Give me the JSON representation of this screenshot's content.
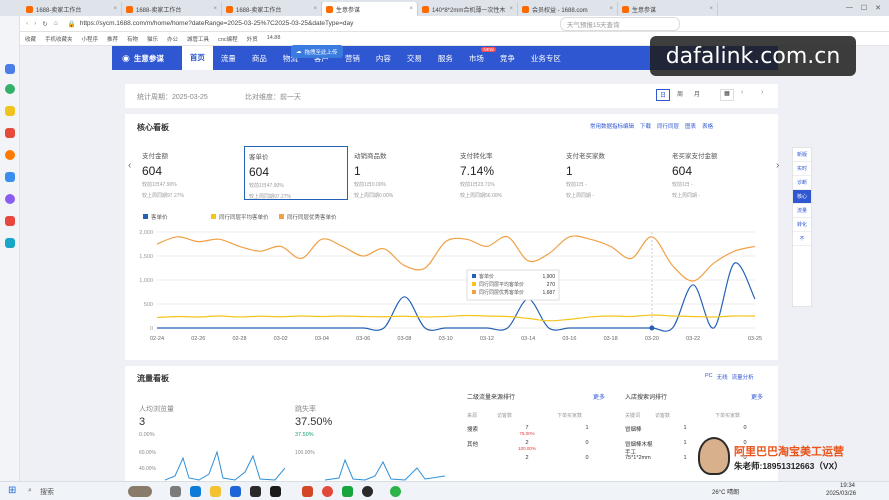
{
  "browser": {
    "tabs": [
      {
        "label": "1688-卖家工作台",
        "active": false
      },
      {
        "label": "1688-卖家工作台",
        "active": false
      },
      {
        "label": "1688-卖家工作台",
        "active": false
      },
      {
        "label": "生意参谋",
        "active": true
      },
      {
        "label": "140*8*2mm合机薄一次性木",
        "active": false
      },
      {
        "label": "会员权益 - 1688.com",
        "active": false
      },
      {
        "label": "生意参谋",
        "active": false
      }
    ],
    "url": "https://sycm.1688.com/m/home/home?dateRange=2025-03-25%7C2025-03-25&dateType=day",
    "search_placeholder": "天气预报15天查询",
    "bookmarks": [
      "收藏",
      "手机收藏夹",
      "小程序",
      "推荐",
      "有物",
      "猫乐",
      "办公",
      "城管工具",
      "cnc编程",
      "外贸",
      "14.88"
    ],
    "upload_badge": "拖拽至此上传"
  },
  "nav": {
    "logo": "生意参谋",
    "items": [
      "首页",
      "流量",
      "商品",
      "物流",
      "客户",
      "营销",
      "内容",
      "交易",
      "服务",
      "市场",
      "竞争",
      "业务专区"
    ],
    "market_badge": "NEW"
  },
  "stats": {
    "period_label": "统计周期：2025-03-25",
    "dim_label": "比对维度：前一天",
    "date_tabs": [
      "日",
      "周",
      "月"
    ]
  },
  "core": {
    "title": "核心看板",
    "links": [
      "常用数据指标编辑",
      "下载",
      "同行同层",
      "图表",
      "表格"
    ],
    "kpis": [
      {
        "title": "支付金额",
        "value": "604",
        "sub1": "较前1日47.90%",
        "sub2": "较上周同期97.27%"
      },
      {
        "title": "客单价",
        "value": "604",
        "sub1": "较前1日47.90%",
        "sub2": "较上周同期97.27%"
      },
      {
        "title": "动销商品数",
        "value": "1",
        "sub1": "较前1日0.00%",
        "sub2": "较上周同期0.00%"
      },
      {
        "title": "支付转化率",
        "value": "7.14%",
        "sub1": "较前1日23.71%",
        "sub2": "较上周同期56.00%"
      },
      {
        "title": "支付老买家数",
        "value": "1",
        "sub1": "较前1日 -",
        "sub2": "较上周同期 -"
      },
      {
        "title": "老买家支付金额",
        "value": "604",
        "sub1": "较前1日 -",
        "sub2": "较上周同期 -"
      }
    ]
  },
  "chart_data": {
    "type": "line",
    "x": [
      "02-24",
      "02-25",
      "02-26",
      "02-27",
      "02-28",
      "03-01",
      "03-02",
      "03-03",
      "03-04",
      "03-05",
      "03-06",
      "03-07",
      "03-08",
      "03-09",
      "03-10",
      "03-11",
      "03-12",
      "03-13",
      "03-14",
      "03-15",
      "03-16",
      "03-17",
      "03-18",
      "03-19",
      "03-20",
      "03-21",
      "03-22",
      "03-23",
      "03-24",
      "03-25"
    ],
    "x_ticks": [
      "02-24",
      "02-26",
      "02-28",
      "03-02",
      "03-04",
      "03-06",
      "03-08",
      "03-10",
      "03-12",
      "03-14",
      "03-16",
      "03-18",
      "03-20",
      "03-22",
      "03-25"
    ],
    "ylim": [
      0,
      2000
    ],
    "y_ticks": [
      "0",
      "500",
      "1,000",
      "1,500",
      "2,000"
    ],
    "series": [
      {
        "name": "客单价",
        "color": "#2461b4",
        "values": [
          0,
          0,
          0,
          0,
          0,
          0,
          0,
          0,
          0,
          0,
          0,
          0,
          650,
          0,
          0,
          0,
          0,
          0,
          600,
          0,
          0,
          0,
          0,
          0,
          0,
          0,
          900,
          0,
          1350,
          604
        ]
      },
      {
        "name": "同行同层平均客单价",
        "color": "#f4c41a",
        "values": [
          220,
          240,
          230,
          250,
          230,
          245,
          235,
          250,
          240,
          250,
          240,
          235,
          245,
          230,
          240,
          260,
          250,
          240,
          200,
          150,
          180,
          230,
          250,
          240,
          270,
          250,
          240,
          230,
          250,
          250
        ]
      },
      {
        "name": "同行同层优秀客单价",
        "color": "#f0a045",
        "values": [
          1750,
          1900,
          1800,
          1850,
          1700,
          1600,
          1700,
          1450,
          1850,
          1700,
          1500,
          1650,
          1300,
          1250,
          1800,
          1850,
          1700,
          1900,
          1400,
          1550,
          1900,
          1850,
          1700,
          1450,
          1900,
          1300,
          980,
          1350,
          1600,
          1700
        ]
      }
    ],
    "legend_placement": "top-left",
    "tooltip": {
      "date": "03-20",
      "rows": [
        {
          "name": "客单价",
          "value": "1,900"
        },
        {
          "name": "同行同层平均客单价",
          "value": "270"
        },
        {
          "name": "同行同层优秀客单价",
          "value": "1,687"
        }
      ]
    }
  },
  "traffic": {
    "title": "流量看板",
    "links": [
      "PC",
      "无线",
      "流量分析"
    ],
    "uv_label": "人均浏览量",
    "uv_value": "3",
    "uv_change": "0.00%",
    "bounce_label": "跳失率",
    "bounce_value": "37.50%",
    "bounce_change": "37.50%",
    "mini_ticks": [
      "60.00%",
      "40.00%",
      "100.00%"
    ],
    "source_title": "二级流量来源排行",
    "source_more": "更多",
    "source_headers": [
      "来源",
      "访客数",
      "下单买家数"
    ],
    "source_rows": [
      {
        "name": "搜索",
        "visitors": "7",
        "vchange": "75.00%",
        "buyers": "1"
      },
      {
        "name": "其他",
        "visitors": "2",
        "vchange": "100.00%",
        "buyers": "0"
      },
      {
        "name": "",
        "visitors": "2",
        "vchange": "",
        "buyers": "0"
      }
    ],
    "keyword_title": "入店搜索词排行",
    "keyword_more": "更多",
    "keyword_headers": [
      "关键词",
      "访客数",
      "下单买家数"
    ],
    "keyword_rows": [
      {
        "name": "冒烟棒",
        "visitors": "1",
        "buyers": "0"
      },
      {
        "name": "冒烟棒木棍手工",
        "visitors": "1",
        "buyers": "0"
      },
      {
        "name": "75*1*2mm",
        "visitors": "1",
        "buyers": "0"
      }
    ]
  },
  "right_panel": [
    "新版",
    "实时",
    "诊断",
    "核心",
    "流量",
    "转化",
    "不"
  ],
  "watermark": "dafalink.com.cn",
  "promo": {
    "title": "阿里巴巴淘宝美工运营",
    "subtitle": "朱老师:18951312663（VX）"
  },
  "taskbar": {
    "search": "搜索",
    "weather": "26°C 晴朗",
    "time": "19:34",
    "date": "2025/03/26"
  }
}
